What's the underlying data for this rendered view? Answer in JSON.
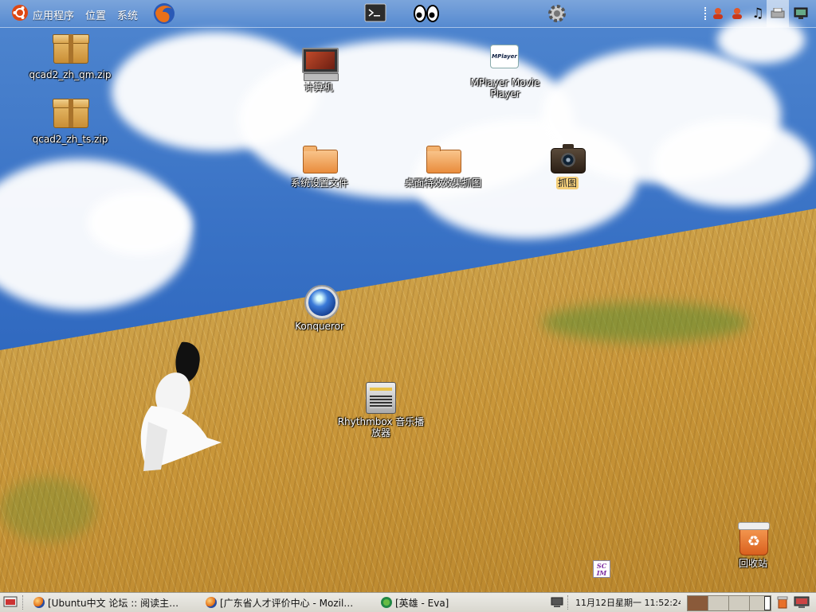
{
  "top_panel": {
    "menus": [
      "应用程序",
      "位置",
      "系统"
    ],
    "launchers": [
      "firefox-icon",
      "terminal-icon",
      "eyes-applet-icon",
      "settings-gear-icon"
    ],
    "tray": [
      "user-status-icon",
      "user-status-icon",
      "music-note-icon",
      "printer-icon",
      "network-monitor-icon"
    ]
  },
  "desktop": {
    "icons": [
      {
        "label": "qcad2_zh_qm.zip",
        "type": "zip"
      },
      {
        "label": "qcad2_zh_ts.zip",
        "type": "zip"
      },
      {
        "label": "计算机",
        "type": "computer"
      },
      {
        "label": "MPlayer Movie Player",
        "type": "mplayer"
      },
      {
        "label": "系统设置文件",
        "type": "folder"
      },
      {
        "label": "桌面特效效果抓图",
        "type": "folder"
      },
      {
        "label": "抓图",
        "type": "camera",
        "selected": true
      },
      {
        "label": "Konqueror",
        "type": "konqueror"
      },
      {
        "label": "Rhythmbox 音乐播放器",
        "type": "rhythmbox"
      },
      {
        "label": "回收站",
        "type": "trash"
      }
    ],
    "scim_label": "SC IM"
  },
  "bottom_panel": {
    "tasks": [
      "[Ubuntu中文 论坛 :: 阅读主…",
      "[广东省人才评价中心 - Mozil…",
      "[英雄 - Eva]"
    ],
    "clock": "11月12日星期一 11:52:24",
    "workspace_colors": [
      "#8a5a3a",
      "#d0ccc0",
      "#d0ccc0",
      "#d0ccc0"
    ]
  }
}
